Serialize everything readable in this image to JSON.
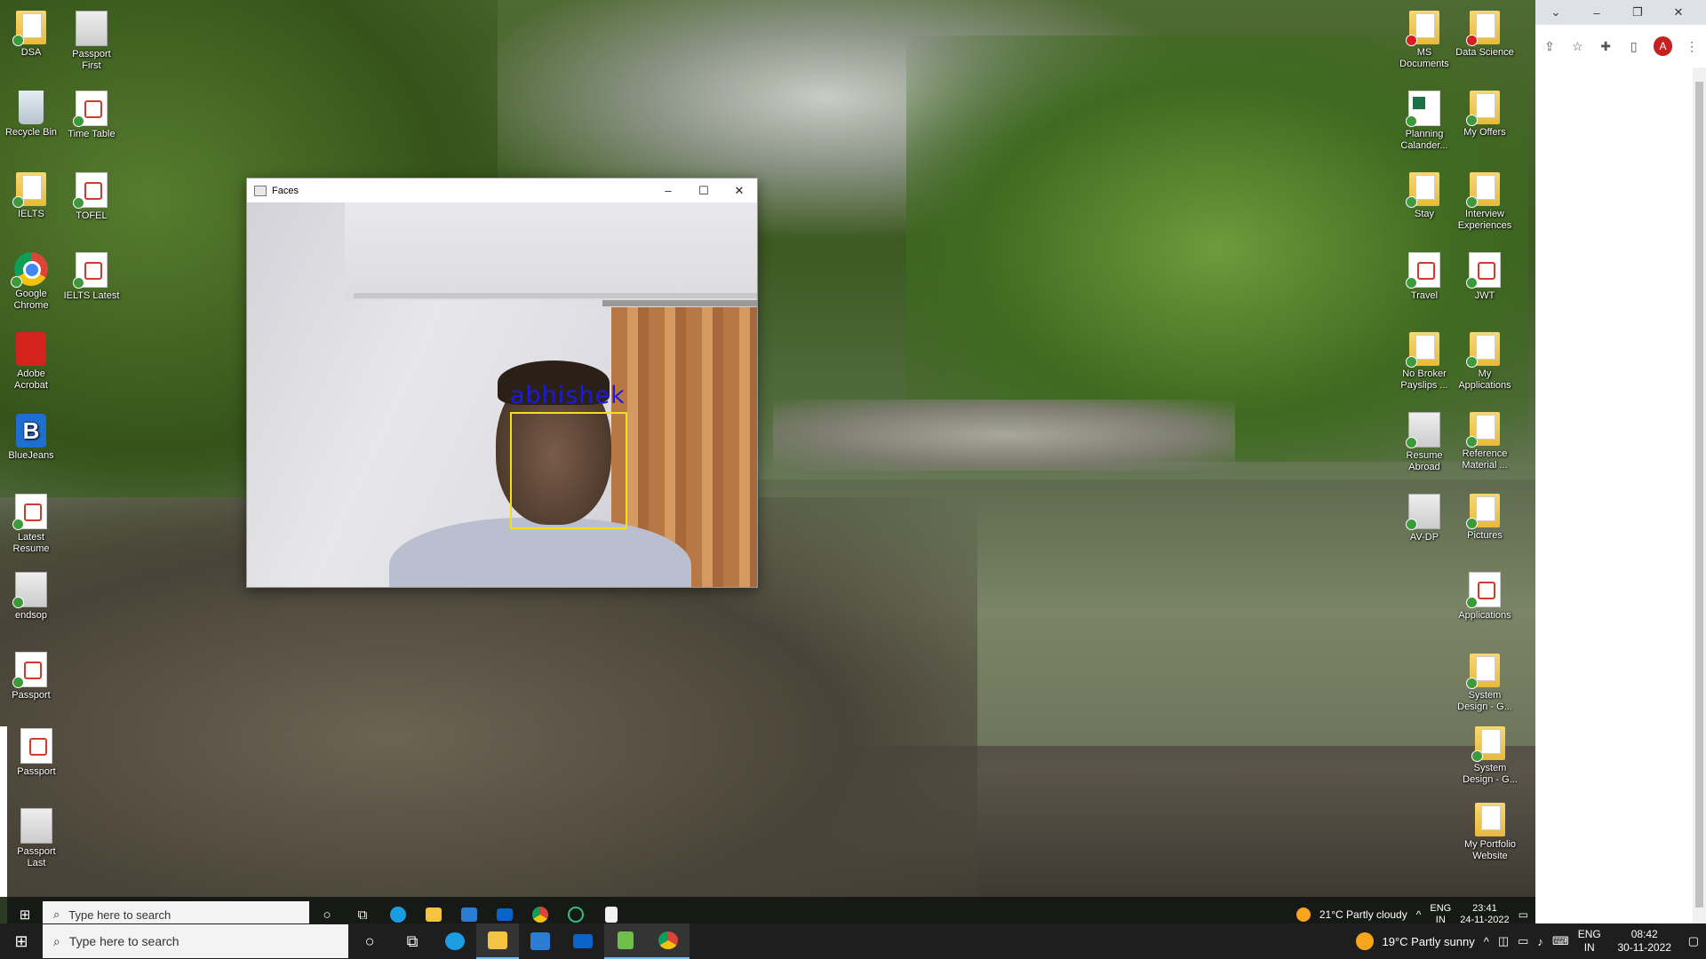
{
  "desktop": {
    "left_icons": [
      {
        "label": "DSA",
        "type": "folder"
      },
      {
        "label": "Passport First",
        "type": "photo"
      },
      {
        "label": "Recycle Bin",
        "type": "bin"
      },
      {
        "label": "Time Table",
        "type": "doc"
      },
      {
        "label": "IELTS",
        "type": "folder"
      },
      {
        "label": "TOFEL",
        "type": "pdf"
      },
      {
        "label": "Google Chrome",
        "type": "chrome"
      },
      {
        "label": "IELTS Latest",
        "type": "pdf"
      },
      {
        "label": "Adobe Acrobat",
        "type": "acrobat"
      },
      {
        "label": "BlueJeans",
        "type": "bluejeans"
      },
      {
        "label": "Latest Resume",
        "type": "pdf"
      },
      {
        "label": "endsop",
        "type": "doc"
      },
      {
        "label": "Passport",
        "type": "pdf"
      },
      {
        "label": "Passport",
        "type": "pdf"
      },
      {
        "label": "Passport Last",
        "type": "photo"
      }
    ],
    "right_icons": [
      {
        "label": "MS Documents",
        "type": "folder"
      },
      {
        "label": "Data Science",
        "type": "folder"
      },
      {
        "label": "Planning Calander...",
        "type": "excel"
      },
      {
        "label": "My Offers",
        "type": "folder"
      },
      {
        "label": "Stay",
        "type": "folder"
      },
      {
        "label": "Interview Experiences",
        "type": "folder"
      },
      {
        "label": "Travel",
        "type": "pdf"
      },
      {
        "label": "JWT",
        "type": "pdf"
      },
      {
        "label": "No Broker Payslips ...",
        "type": "folder"
      },
      {
        "label": "My Applications",
        "type": "folder"
      },
      {
        "label": "Resume Abroad",
        "type": "doc"
      },
      {
        "label": "Reference Material ...",
        "type": "folder"
      },
      {
        "label": "AV-DP",
        "type": "photo"
      },
      {
        "label": "Pictures",
        "type": "folder"
      },
      {
        "label": "Applications",
        "type": "doc"
      },
      {
        "label": "System Design - G...",
        "type": "folder"
      },
      {
        "label": "System Design - G...",
        "type": "folder"
      },
      {
        "label": "My Portfolio Website",
        "type": "folder"
      }
    ]
  },
  "faces_window": {
    "title": "Faces",
    "minimize": "–",
    "maximize": "☐",
    "close": "✕",
    "detected_name": "abhishek"
  },
  "chrome_partial": {
    "tab_controls": [
      "⌄",
      "–",
      "❐",
      "✕"
    ],
    "toolbar_icons": [
      "⇪",
      "☆",
      "✚",
      "▯"
    ],
    "avatar_letter": "A",
    "menu": "⋮"
  },
  "taskbar_back": {
    "search_placeholder": "Type here to search",
    "weather": "21°C  Partly cloudy",
    "lang_top": "ENG",
    "lang_bottom": "IN",
    "time": "23:41",
    "date": "24-11-2022"
  },
  "taskbar": {
    "search_placeholder": "Type here to search",
    "weather": "19°C  Partly sunny",
    "lang_top": "ENG",
    "lang_bottom": "IN",
    "time": "08:42",
    "date": "30-11-2022",
    "apps": [
      "cortana",
      "task-view",
      "edge",
      "file-explorer",
      "store",
      "mail",
      "notepad",
      "chrome"
    ]
  }
}
